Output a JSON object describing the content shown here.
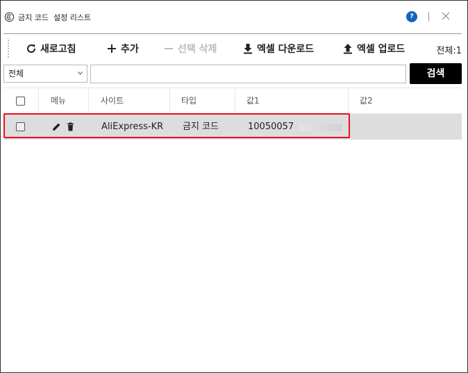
{
  "window": {
    "title": "금지 코드  설정 리스트",
    "help_label": "?"
  },
  "toolbar": {
    "refresh_label": "새로고침",
    "add_label": "추가",
    "delete_selected_label": "선택 삭제",
    "excel_download_label": "엑셀 다운로드",
    "excel_upload_label": "엑셀 업로드",
    "total_count": "전체:1"
  },
  "filter": {
    "select_value": "전체",
    "search_value": "",
    "search_button_label": "검색"
  },
  "grid": {
    "columns": [
      "메뉴",
      "사이트",
      "타입",
      "값1",
      "값2"
    ],
    "rows": [
      {
        "site": "AliExpress-KR",
        "type": "금지 코드",
        "value1": "10050057",
        "value2": ""
      }
    ]
  },
  "colors": {
    "highlight": "#e8101a",
    "help_icon": "#1565c0",
    "search_button": "#000000",
    "row_background": "#dddddd"
  }
}
